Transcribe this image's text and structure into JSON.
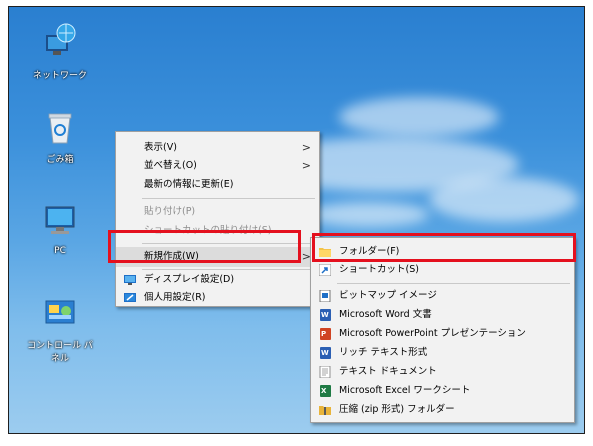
{
  "desktop_icons": [
    {
      "label": "ネットワーク",
      "icon": "network-icon"
    },
    {
      "label": "ごみ箱",
      "icon": "recycle-bin-icon"
    },
    {
      "label": "PC",
      "icon": "pc-icon"
    },
    {
      "label": "コントロール パネル",
      "icon": "control-panel-icon"
    }
  ],
  "context_menu": {
    "view": "表示(V)",
    "sort": "並べ替え(O)",
    "refresh": "最新の情報に更新(E)",
    "paste": "貼り付け(P)",
    "paste_shortcut": "ショートカットの貼り付け(S)",
    "new": "新規作成(W)",
    "display_settings": "ディスプレイ設定(D)",
    "personalize": "個人用設定(R)"
  },
  "submenu": {
    "folder": "フォルダー(F)",
    "shortcut": "ショートカット(S)",
    "bitmap": "ビットマップ イメージ",
    "word": "Microsoft Word 文書",
    "powerpoint": "Microsoft PowerPoint プレゼンテーション",
    "rtf": "リッチ テキスト形式",
    "text": "テキスト ドキュメント",
    "excel": "Microsoft Excel ワークシート",
    "zip": "圧縮 (zip 形式) フォルダー"
  },
  "colors": {
    "highlight_border": "#e4101e",
    "menu_bg": "#f2f2f2",
    "desktop_blue": "#3b90db"
  }
}
